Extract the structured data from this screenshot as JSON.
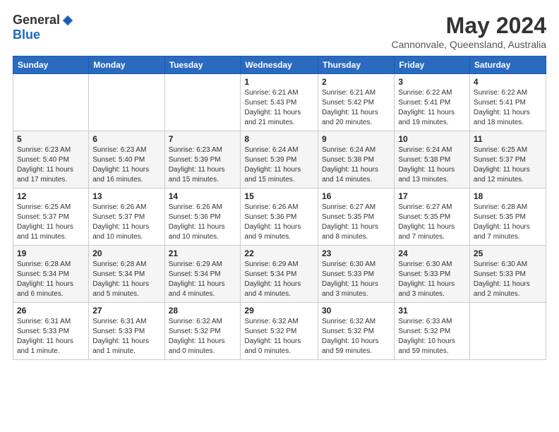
{
  "logo": {
    "general": "General",
    "blue": "Blue"
  },
  "title": "May 2024",
  "subtitle": "Cannonvale, Queensland, Australia",
  "days_of_week": [
    "Sunday",
    "Monday",
    "Tuesday",
    "Wednesday",
    "Thursday",
    "Friday",
    "Saturday"
  ],
  "weeks": [
    [
      {
        "day": "",
        "info": ""
      },
      {
        "day": "",
        "info": ""
      },
      {
        "day": "",
        "info": ""
      },
      {
        "day": "1",
        "info": "Sunrise: 6:21 AM\nSunset: 5:43 PM\nDaylight: 11 hours\nand 21 minutes."
      },
      {
        "day": "2",
        "info": "Sunrise: 6:21 AM\nSunset: 5:42 PM\nDaylight: 11 hours\nand 20 minutes."
      },
      {
        "day": "3",
        "info": "Sunrise: 6:22 AM\nSunset: 5:41 PM\nDaylight: 11 hours\nand 19 minutes."
      },
      {
        "day": "4",
        "info": "Sunrise: 6:22 AM\nSunset: 5:41 PM\nDaylight: 11 hours\nand 18 minutes."
      }
    ],
    [
      {
        "day": "5",
        "info": "Sunrise: 6:23 AM\nSunset: 5:40 PM\nDaylight: 11 hours\nand 17 minutes."
      },
      {
        "day": "6",
        "info": "Sunrise: 6:23 AM\nSunset: 5:40 PM\nDaylight: 11 hours\nand 16 minutes."
      },
      {
        "day": "7",
        "info": "Sunrise: 6:23 AM\nSunset: 5:39 PM\nDaylight: 11 hours\nand 15 minutes."
      },
      {
        "day": "8",
        "info": "Sunrise: 6:24 AM\nSunset: 5:39 PM\nDaylight: 11 hours\nand 15 minutes."
      },
      {
        "day": "9",
        "info": "Sunrise: 6:24 AM\nSunset: 5:38 PM\nDaylight: 11 hours\nand 14 minutes."
      },
      {
        "day": "10",
        "info": "Sunrise: 6:24 AM\nSunset: 5:38 PM\nDaylight: 11 hours\nand 13 minutes."
      },
      {
        "day": "11",
        "info": "Sunrise: 6:25 AM\nSunset: 5:37 PM\nDaylight: 11 hours\nand 12 minutes."
      }
    ],
    [
      {
        "day": "12",
        "info": "Sunrise: 6:25 AM\nSunset: 5:37 PM\nDaylight: 11 hours\nand 11 minutes."
      },
      {
        "day": "13",
        "info": "Sunrise: 6:26 AM\nSunset: 5:37 PM\nDaylight: 11 hours\nand 10 minutes."
      },
      {
        "day": "14",
        "info": "Sunrise: 6:26 AM\nSunset: 5:36 PM\nDaylight: 11 hours\nand 10 minutes."
      },
      {
        "day": "15",
        "info": "Sunrise: 6:26 AM\nSunset: 5:36 PM\nDaylight: 11 hours\nand 9 minutes."
      },
      {
        "day": "16",
        "info": "Sunrise: 6:27 AM\nSunset: 5:35 PM\nDaylight: 11 hours\nand 8 minutes."
      },
      {
        "day": "17",
        "info": "Sunrise: 6:27 AM\nSunset: 5:35 PM\nDaylight: 11 hours\nand 7 minutes."
      },
      {
        "day": "18",
        "info": "Sunrise: 6:28 AM\nSunset: 5:35 PM\nDaylight: 11 hours\nand 7 minutes."
      }
    ],
    [
      {
        "day": "19",
        "info": "Sunrise: 6:28 AM\nSunset: 5:34 PM\nDaylight: 11 hours\nand 6 minutes."
      },
      {
        "day": "20",
        "info": "Sunrise: 6:28 AM\nSunset: 5:34 PM\nDaylight: 11 hours\nand 5 minutes."
      },
      {
        "day": "21",
        "info": "Sunrise: 6:29 AM\nSunset: 5:34 PM\nDaylight: 11 hours\nand 4 minutes."
      },
      {
        "day": "22",
        "info": "Sunrise: 6:29 AM\nSunset: 5:34 PM\nDaylight: 11 hours\nand 4 minutes."
      },
      {
        "day": "23",
        "info": "Sunrise: 6:30 AM\nSunset: 5:33 PM\nDaylight: 11 hours\nand 3 minutes."
      },
      {
        "day": "24",
        "info": "Sunrise: 6:30 AM\nSunset: 5:33 PM\nDaylight: 11 hours\nand 3 minutes."
      },
      {
        "day": "25",
        "info": "Sunrise: 6:30 AM\nSunset: 5:33 PM\nDaylight: 11 hours\nand 2 minutes."
      }
    ],
    [
      {
        "day": "26",
        "info": "Sunrise: 6:31 AM\nSunset: 5:33 PM\nDaylight: 11 hours\nand 1 minute."
      },
      {
        "day": "27",
        "info": "Sunrise: 6:31 AM\nSunset: 5:33 PM\nDaylight: 11 hours\nand 1 minute."
      },
      {
        "day": "28",
        "info": "Sunrise: 6:32 AM\nSunset: 5:32 PM\nDaylight: 11 hours\nand 0 minutes."
      },
      {
        "day": "29",
        "info": "Sunrise: 6:32 AM\nSunset: 5:32 PM\nDaylight: 11 hours\nand 0 minutes."
      },
      {
        "day": "30",
        "info": "Sunrise: 6:32 AM\nSunset: 5:32 PM\nDaylight: 10 hours\nand 59 minutes."
      },
      {
        "day": "31",
        "info": "Sunrise: 6:33 AM\nSunset: 5:32 PM\nDaylight: 10 hours\nand 59 minutes."
      },
      {
        "day": "",
        "info": ""
      }
    ]
  ]
}
